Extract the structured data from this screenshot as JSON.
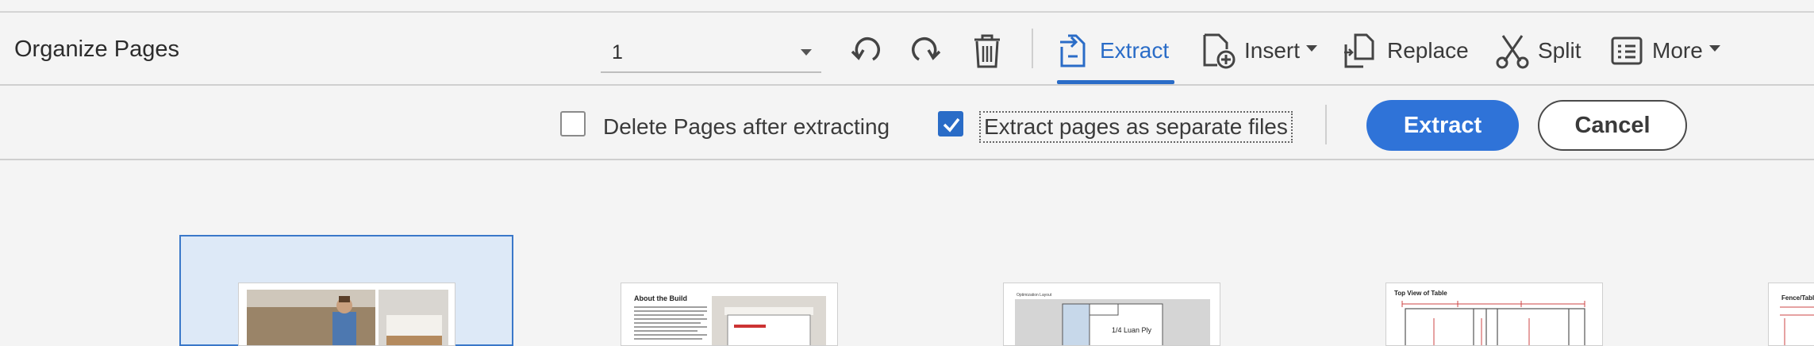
{
  "toolbar": {
    "title": "Organize Pages",
    "page_select_value": "1",
    "undo_icon": "undo-icon",
    "redo_icon": "redo-icon",
    "delete_icon": "trash-icon",
    "extract_label": "Extract",
    "insert_label": "Insert",
    "replace_label": "Replace",
    "split_label": "Split",
    "more_label": "More",
    "accent_color": "#2a6cc7"
  },
  "extract_options": {
    "delete_after_label": "Delete Pages after extracting",
    "delete_after_checked": false,
    "separate_files_label": "Extract pages as separate files",
    "separate_files_checked": true,
    "extract_button": "Extract",
    "cancel_button": "Cancel"
  },
  "pages": [
    {
      "title": ""
    },
    {
      "title": "About the Build"
    },
    {
      "title": "Optimization Layout",
      "label": "1/4 Luan Ply"
    },
    {
      "title": "Top View of Table"
    },
    {
      "title": "Fence/Table"
    }
  ]
}
